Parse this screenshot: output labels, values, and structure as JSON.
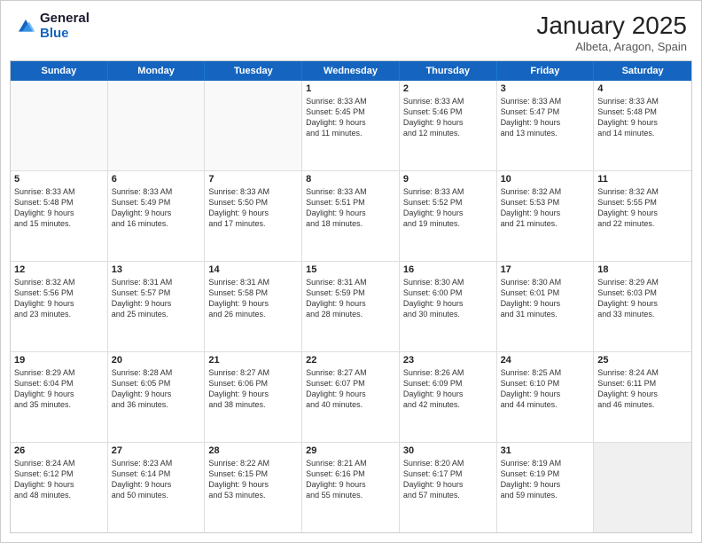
{
  "logo": {
    "general": "General",
    "blue": "Blue"
  },
  "header": {
    "month": "January 2025",
    "location": "Albeta, Aragon, Spain"
  },
  "weekdays": [
    "Sunday",
    "Monday",
    "Tuesday",
    "Wednesday",
    "Thursday",
    "Friday",
    "Saturday"
  ],
  "rows": [
    [
      {
        "day": "",
        "info": "",
        "empty": true
      },
      {
        "day": "",
        "info": "",
        "empty": true
      },
      {
        "day": "",
        "info": "",
        "empty": true
      },
      {
        "day": "1",
        "info": "Sunrise: 8:33 AM\nSunset: 5:45 PM\nDaylight: 9 hours\nand 11 minutes."
      },
      {
        "day": "2",
        "info": "Sunrise: 8:33 AM\nSunset: 5:46 PM\nDaylight: 9 hours\nand 12 minutes."
      },
      {
        "day": "3",
        "info": "Sunrise: 8:33 AM\nSunset: 5:47 PM\nDaylight: 9 hours\nand 13 minutes."
      },
      {
        "day": "4",
        "info": "Sunrise: 8:33 AM\nSunset: 5:48 PM\nDaylight: 9 hours\nand 14 minutes."
      }
    ],
    [
      {
        "day": "5",
        "info": "Sunrise: 8:33 AM\nSunset: 5:48 PM\nDaylight: 9 hours\nand 15 minutes."
      },
      {
        "day": "6",
        "info": "Sunrise: 8:33 AM\nSunset: 5:49 PM\nDaylight: 9 hours\nand 16 minutes."
      },
      {
        "day": "7",
        "info": "Sunrise: 8:33 AM\nSunset: 5:50 PM\nDaylight: 9 hours\nand 17 minutes."
      },
      {
        "day": "8",
        "info": "Sunrise: 8:33 AM\nSunset: 5:51 PM\nDaylight: 9 hours\nand 18 minutes."
      },
      {
        "day": "9",
        "info": "Sunrise: 8:33 AM\nSunset: 5:52 PM\nDaylight: 9 hours\nand 19 minutes."
      },
      {
        "day": "10",
        "info": "Sunrise: 8:32 AM\nSunset: 5:53 PM\nDaylight: 9 hours\nand 21 minutes."
      },
      {
        "day": "11",
        "info": "Sunrise: 8:32 AM\nSunset: 5:55 PM\nDaylight: 9 hours\nand 22 minutes."
      }
    ],
    [
      {
        "day": "12",
        "info": "Sunrise: 8:32 AM\nSunset: 5:56 PM\nDaylight: 9 hours\nand 23 minutes."
      },
      {
        "day": "13",
        "info": "Sunrise: 8:31 AM\nSunset: 5:57 PM\nDaylight: 9 hours\nand 25 minutes."
      },
      {
        "day": "14",
        "info": "Sunrise: 8:31 AM\nSunset: 5:58 PM\nDaylight: 9 hours\nand 26 minutes."
      },
      {
        "day": "15",
        "info": "Sunrise: 8:31 AM\nSunset: 5:59 PM\nDaylight: 9 hours\nand 28 minutes."
      },
      {
        "day": "16",
        "info": "Sunrise: 8:30 AM\nSunset: 6:00 PM\nDaylight: 9 hours\nand 30 minutes."
      },
      {
        "day": "17",
        "info": "Sunrise: 8:30 AM\nSunset: 6:01 PM\nDaylight: 9 hours\nand 31 minutes."
      },
      {
        "day": "18",
        "info": "Sunrise: 8:29 AM\nSunset: 6:03 PM\nDaylight: 9 hours\nand 33 minutes."
      }
    ],
    [
      {
        "day": "19",
        "info": "Sunrise: 8:29 AM\nSunset: 6:04 PM\nDaylight: 9 hours\nand 35 minutes."
      },
      {
        "day": "20",
        "info": "Sunrise: 8:28 AM\nSunset: 6:05 PM\nDaylight: 9 hours\nand 36 minutes."
      },
      {
        "day": "21",
        "info": "Sunrise: 8:27 AM\nSunset: 6:06 PM\nDaylight: 9 hours\nand 38 minutes."
      },
      {
        "day": "22",
        "info": "Sunrise: 8:27 AM\nSunset: 6:07 PM\nDaylight: 9 hours\nand 40 minutes."
      },
      {
        "day": "23",
        "info": "Sunrise: 8:26 AM\nSunset: 6:09 PM\nDaylight: 9 hours\nand 42 minutes."
      },
      {
        "day": "24",
        "info": "Sunrise: 8:25 AM\nSunset: 6:10 PM\nDaylight: 9 hours\nand 44 minutes."
      },
      {
        "day": "25",
        "info": "Sunrise: 8:24 AM\nSunset: 6:11 PM\nDaylight: 9 hours\nand 46 minutes."
      }
    ],
    [
      {
        "day": "26",
        "info": "Sunrise: 8:24 AM\nSunset: 6:12 PM\nDaylight: 9 hours\nand 48 minutes."
      },
      {
        "day": "27",
        "info": "Sunrise: 8:23 AM\nSunset: 6:14 PM\nDaylight: 9 hours\nand 50 minutes."
      },
      {
        "day": "28",
        "info": "Sunrise: 8:22 AM\nSunset: 6:15 PM\nDaylight: 9 hours\nand 53 minutes."
      },
      {
        "day": "29",
        "info": "Sunrise: 8:21 AM\nSunset: 6:16 PM\nDaylight: 9 hours\nand 55 minutes."
      },
      {
        "day": "30",
        "info": "Sunrise: 8:20 AM\nSunset: 6:17 PM\nDaylight: 9 hours\nand 57 minutes."
      },
      {
        "day": "31",
        "info": "Sunrise: 8:19 AM\nSunset: 6:19 PM\nDaylight: 9 hours\nand 59 minutes."
      },
      {
        "day": "",
        "info": "",
        "empty": true,
        "shaded": true
      }
    ]
  ]
}
